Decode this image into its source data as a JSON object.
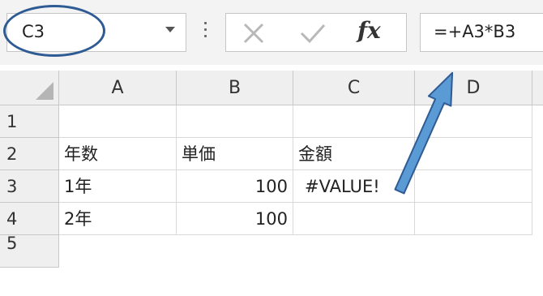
{
  "formula_bar": {
    "name_box": "C3",
    "fx_label": "fx",
    "formula": "=+A3*B3"
  },
  "sheet": {
    "columns": [
      "A",
      "B",
      "C",
      "D"
    ],
    "rows": [
      "1",
      "2",
      "3",
      "4",
      "5"
    ],
    "cells": {
      "A2": "年数",
      "B2": "単価",
      "C2": "金額",
      "A3": "1年",
      "B3": "100",
      "C3": "#VALUE!",
      "A4": "2年",
      "B4": "100"
    }
  },
  "colors": {
    "annotation_circle": "#2f5b94",
    "annotation_arrow": "#5b9bd5"
  },
  "icons": [
    "dropdown-icon",
    "kebab-icon",
    "cancel-icon",
    "enter-icon",
    "fx-icon"
  ]
}
